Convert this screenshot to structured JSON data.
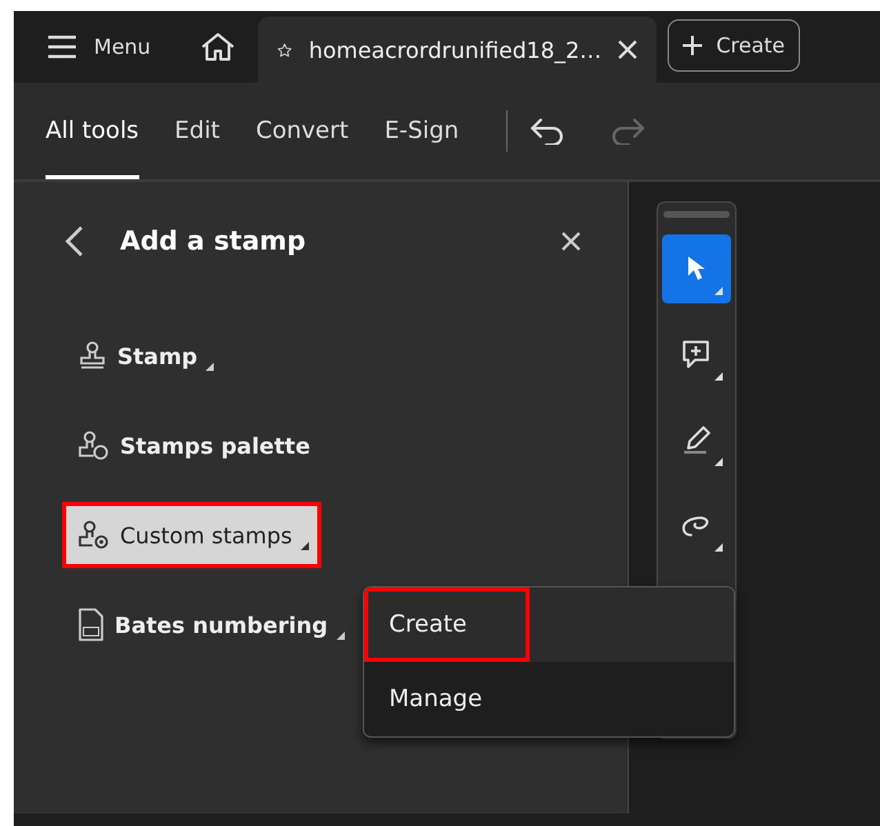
{
  "top_bar": {
    "menu_label": "Menu",
    "tab": {
      "title": "homeacrordrunified18_2…",
      "selected": true
    },
    "create_label": "Create"
  },
  "toolbar": {
    "tabs": [
      {
        "label": "All tools",
        "selected": true
      },
      {
        "label": "Edit",
        "selected": false
      },
      {
        "label": "Convert",
        "selected": false
      },
      {
        "label": "E-Sign",
        "selected": false
      }
    ],
    "undo_disabled": false,
    "redo_disabled": true
  },
  "panel": {
    "title": "Add a stamp",
    "items": [
      {
        "kind": "stamp",
        "label": "Stamp",
        "has_submenu": true,
        "hovered": false,
        "outlined": false
      },
      {
        "kind": "palette",
        "label": "Stamps palette",
        "has_submenu": false,
        "hovered": false,
        "outlined": false
      },
      {
        "kind": "custom",
        "label": "Custom stamps",
        "has_submenu": true,
        "hovered": true,
        "outlined": true
      },
      {
        "kind": "bates",
        "label": "Bates numbering",
        "has_submenu": true,
        "hovered": false,
        "outlined": false
      }
    ]
  },
  "tool_strip": {
    "tools": [
      {
        "kind": "select",
        "selected": true
      },
      {
        "kind": "comment",
        "selected": false
      },
      {
        "kind": "highlight",
        "selected": false
      },
      {
        "kind": "freeform",
        "selected": false
      }
    ]
  },
  "context_menu": {
    "items": [
      {
        "label": "Create",
        "hovered": true,
        "outlined": true
      },
      {
        "label": "Manage",
        "hovered": false,
        "outlined": false
      }
    ]
  }
}
